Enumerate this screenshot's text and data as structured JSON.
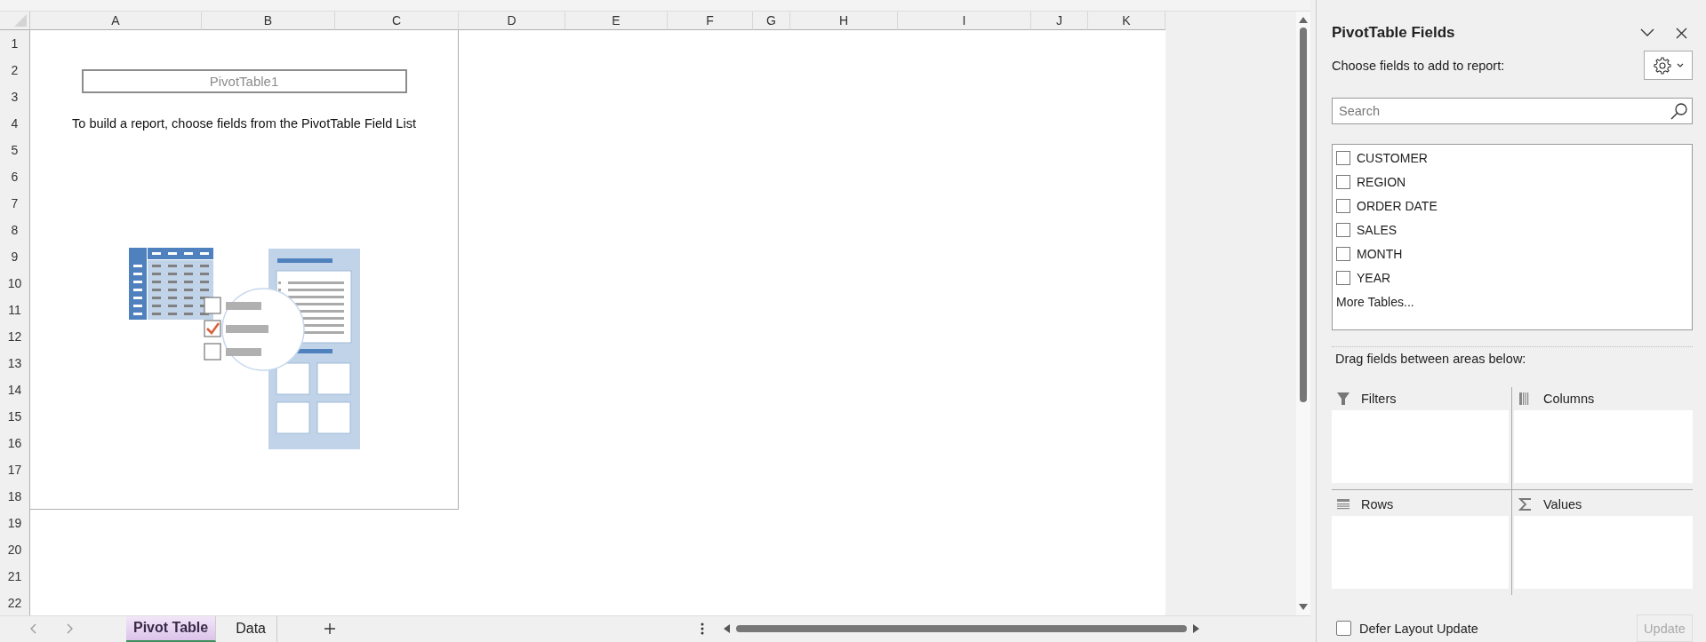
{
  "sheet": {
    "columns": [
      "A",
      "B",
      "C",
      "D",
      "E",
      "F",
      "G",
      "H",
      "I",
      "J",
      "K"
    ],
    "rows": [
      "1",
      "2",
      "3",
      "4",
      "5",
      "6",
      "7",
      "8",
      "9",
      "10",
      "11",
      "12",
      "13",
      "14",
      "15",
      "16",
      "17",
      "18",
      "19",
      "20",
      "21",
      "22"
    ],
    "pivot_placeholder": {
      "title": "PivotTable1",
      "instruction": "To build a report, choose fields from the PivotTable Field List"
    }
  },
  "sheet_tabs": [
    {
      "label": "Pivot Table",
      "selected": true
    },
    {
      "label": "Data",
      "selected": false
    }
  ],
  "field_panel": {
    "title": "PivotTable Fields",
    "subtitle": "Choose fields to add to report:",
    "search": {
      "placeholder": "Search"
    },
    "fields": [
      {
        "label": "CUSTOMER",
        "checked": false
      },
      {
        "label": "REGION",
        "checked": false
      },
      {
        "label": "ORDER DATE",
        "checked": false
      },
      {
        "label": "SALES",
        "checked": false
      },
      {
        "label": "MONTH",
        "checked": false
      },
      {
        "label": "YEAR",
        "checked": false
      }
    ],
    "more_tables": "More Tables...",
    "drag_hint": "Drag fields between areas below:",
    "areas": [
      {
        "kind": "filters",
        "label": "Filters"
      },
      {
        "kind": "columns",
        "label": "Columns"
      },
      {
        "kind": "rows",
        "label": "Rows"
      },
      {
        "kind": "values",
        "label": "Values"
      }
    ],
    "defer_update": {
      "label": "Defer Layout Update",
      "checked": false
    },
    "update_button": {
      "label": "Update",
      "disabled": true
    }
  }
}
